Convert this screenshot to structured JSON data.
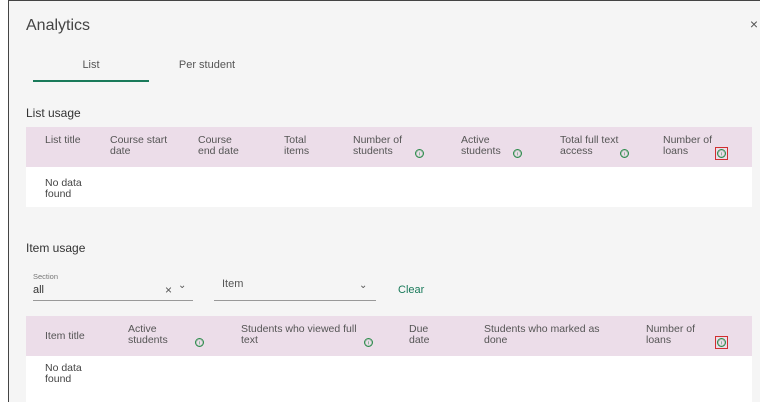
{
  "dialog": {
    "title": "Analytics",
    "close_label": "×"
  },
  "tabs": [
    {
      "label": "List"
    },
    {
      "label": "Per student"
    }
  ],
  "list_usage": {
    "title": "List usage",
    "columns": [
      "List title",
      "Course start date",
      "Course end date",
      "Total items",
      "Number of students",
      "Active students",
      "Total full text access",
      "Number of loans"
    ],
    "empty_text": "No data found"
  },
  "item_usage": {
    "title": "Item usage",
    "section_label": "Section",
    "section_value": "all",
    "clear_icon": "×",
    "chevron_icon": "⌄",
    "item_placeholder": "Item",
    "clear_label": "Clear",
    "columns": [
      "Item title",
      "Active students",
      "Students who viewed full text",
      "Due date",
      "Students who marked as done",
      "Number of loans"
    ],
    "empty_text": "No data found"
  },
  "icons": {
    "info": "ⓘ"
  }
}
